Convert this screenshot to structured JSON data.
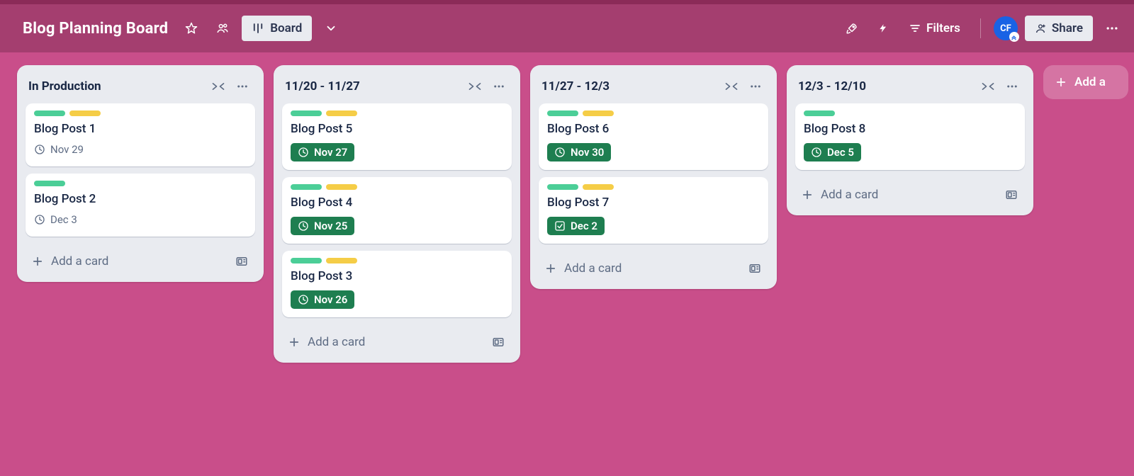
{
  "header": {
    "board_title": "Blog Planning Board",
    "view_label": "Board",
    "filters_label": "Filters",
    "share_label": "Share",
    "avatar_initials": "CF"
  },
  "add_list_label": "Add a",
  "add_card_label": "Add a card",
  "lists": [
    {
      "title": "In Production",
      "cards": [
        {
          "title": "Blog Post 1",
          "labels": [
            "green",
            "yellow"
          ],
          "due": "Nov 29",
          "due_style": "plain",
          "due_icon": "clock"
        },
        {
          "title": "Blog Post 2",
          "labels": [
            "green"
          ],
          "due": "Dec 3",
          "due_style": "plain",
          "due_icon": "clock"
        }
      ]
    },
    {
      "title": "11/20 - 11/27",
      "cards": [
        {
          "title": "Blog Post 5",
          "labels": [
            "green",
            "yellow"
          ],
          "due": "Nov 27",
          "due_style": "green",
          "due_icon": "clock"
        },
        {
          "title": "Blog Post 4",
          "labels": [
            "green",
            "yellow"
          ],
          "due": "Nov 25",
          "due_style": "green",
          "due_icon": "clock"
        },
        {
          "title": "Blog Post 3",
          "labels": [
            "green",
            "yellow"
          ],
          "due": "Nov 26",
          "due_style": "green",
          "due_icon": "clock"
        }
      ]
    },
    {
      "title": "11/27 - 12/3",
      "cards": [
        {
          "title": "Blog Post 6",
          "labels": [
            "green",
            "yellow"
          ],
          "due": "Nov 30",
          "due_style": "green",
          "due_icon": "clock"
        },
        {
          "title": "Blog Post 7",
          "labels": [
            "green",
            "yellow"
          ],
          "due": "Dec 2",
          "due_style": "green",
          "due_icon": "check"
        }
      ]
    },
    {
      "title": "12/3 - 12/10",
      "cards": [
        {
          "title": "Blog Post 8",
          "labels": [
            "green"
          ],
          "due": "Dec 5",
          "due_style": "green",
          "due_icon": "clock"
        }
      ]
    }
  ]
}
